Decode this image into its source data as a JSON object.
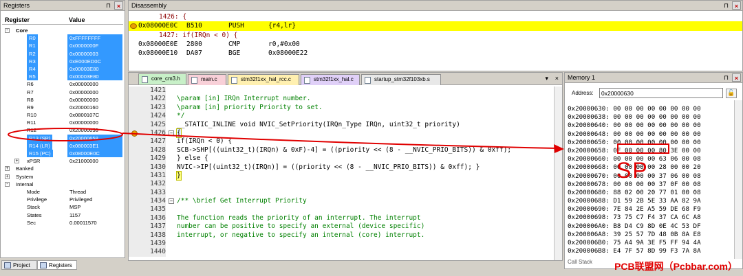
{
  "registers": {
    "title": "Registers",
    "col_register": "Register",
    "col_value": "Value",
    "rows": [
      {
        "name": "Core",
        "value": "",
        "indent": 0,
        "toggle": "-",
        "sel": false,
        "bold": true
      },
      {
        "name": "R0",
        "value": "0xFFFFFFFF",
        "indent": 2,
        "toggle": "",
        "sel": true
      },
      {
        "name": "R1",
        "value": "0x0000000F",
        "indent": 2,
        "toggle": "",
        "sel": true
      },
      {
        "name": "R2",
        "value": "0x00000003",
        "indent": 2,
        "toggle": "",
        "sel": true
      },
      {
        "name": "R3",
        "value": "0xE000ED0C",
        "indent": 2,
        "toggle": "",
        "sel": true
      },
      {
        "name": "R4",
        "value": "0x00003E80",
        "indent": 2,
        "toggle": "",
        "sel": true
      },
      {
        "name": "R5",
        "value": "0x00003E80",
        "indent": 2,
        "toggle": "",
        "sel": true
      },
      {
        "name": "R6",
        "value": "0x00000000",
        "indent": 2,
        "toggle": "",
        "sel": false
      },
      {
        "name": "R7",
        "value": "0x00000000",
        "indent": 2,
        "toggle": "",
        "sel": false
      },
      {
        "name": "R8",
        "value": "0x00000000",
        "indent": 2,
        "toggle": "",
        "sel": false
      },
      {
        "name": "R9",
        "value": "0x20000160",
        "indent": 2,
        "toggle": "",
        "sel": false
      },
      {
        "name": "R10",
        "value": "0x0800107C",
        "indent": 2,
        "toggle": "",
        "sel": false
      },
      {
        "name": "R11",
        "value": "0x00000000",
        "indent": 2,
        "toggle": "",
        "sel": false
      },
      {
        "name": "R12",
        "value": "0x20000058",
        "indent": 2,
        "toggle": "",
        "sel": false
      },
      {
        "name": "R13 (SP)",
        "value": "0x20000658",
        "indent": 2,
        "toggle": "",
        "sel": true
      },
      {
        "name": "R14 (LR)",
        "value": "0x080003E1",
        "indent": 2,
        "toggle": "",
        "sel": true
      },
      {
        "name": "R15 (PC)",
        "value": "0x08000E0C",
        "indent": 2,
        "toggle": "",
        "sel": true
      },
      {
        "name": "xPSR",
        "value": "0x21000000",
        "indent": 2,
        "toggle": "+",
        "sel": false
      },
      {
        "name": "Banked",
        "value": "",
        "indent": 0,
        "toggle": "+",
        "sel": false
      },
      {
        "name": "System",
        "value": "",
        "indent": 0,
        "toggle": "+",
        "sel": false
      },
      {
        "name": "Internal",
        "value": "",
        "indent": 0,
        "toggle": "-",
        "sel": false
      },
      {
        "name": "Mode",
        "value": "Thread",
        "indent": 2,
        "toggle": "",
        "sel": false
      },
      {
        "name": "Privilege",
        "value": "Privileged",
        "indent": 2,
        "toggle": "",
        "sel": false
      },
      {
        "name": "Stack",
        "value": "MSP",
        "indent": 2,
        "toggle": "",
        "sel": false
      },
      {
        "name": "States",
        "value": "1157",
        "indent": 2,
        "toggle": "",
        "sel": false
      },
      {
        "name": "Sec",
        "value": "0.00011570",
        "indent": 2,
        "toggle": "",
        "sel": false
      }
    ],
    "tab_project": "Project",
    "tab_registers": "Registers"
  },
  "disassembly": {
    "title": "Disassembly",
    "rows": [
      {
        "text": "1426: {",
        "src": true,
        "hl": false,
        "a": "",
        "b": "",
        "c": "",
        "d": ""
      },
      {
        "text": "",
        "src": false,
        "hl": true,
        "a": "0x08000E0C",
        "b": "B510",
        "c": "PUSH",
        "d": "{r4,lr}"
      },
      {
        "text": "1427:   if(IRQn < 0) {",
        "src": true,
        "hl": false,
        "a": "",
        "b": "",
        "c": "",
        "d": ""
      },
      {
        "text": "",
        "src": false,
        "hl": false,
        "a": "0x08000E0E",
        "b": "2800",
        "c": "CMP",
        "d": "r0,#0x00"
      },
      {
        "text": "",
        "src": false,
        "hl": false,
        "a": "0x08000E10",
        "b": "DA07",
        "c": "BGE",
        "d": "0x08000E22"
      }
    ]
  },
  "editor": {
    "tabs": [
      {
        "label": "core_cm3.h",
        "color": "#c8f0c8",
        "active": true
      },
      {
        "label": "main.c",
        "color": "#f8d0d8",
        "active": false
      },
      {
        "label": "stm32f1xx_hal_rcc.c",
        "color": "#fff0b0",
        "active": false
      },
      {
        "label": "stm32f1xx_hal.c",
        "color": "#e0d0f8",
        "active": false
      },
      {
        "label": "startup_stm32f103xb.s",
        "color": "#e8e8e8",
        "active": false
      }
    ],
    "lines": [
      {
        "n": "1421",
        "t": "",
        "cls": "cmt"
      },
      {
        "n": "1422",
        "t": "  \\param [in]      IRQn  Interrupt number.",
        "cls": "cmt"
      },
      {
        "n": "1423",
        "t": "  \\param [in]  priority  Priority to set.",
        "cls": "cmt"
      },
      {
        "n": "1424",
        "t": "*/",
        "cls": "cmt"
      },
      {
        "n": "1425",
        "t": "__STATIC_INLINE void NVIC_SetPriority(IRQn_Type IRQn, uint32_t priority)",
        "cls": ""
      },
      {
        "n": "1426",
        "t": "{",
        "cls": "cur"
      },
      {
        "n": "1427",
        "t": "  if(IRQn < 0) {",
        "cls": ""
      },
      {
        "n": "1428",
        "t": "    SCB->SHP[((uint32_t)(IRQn) & 0xF)-4] = ((priority << (8 - __NVIC_PRIO_BITS)) & 0xff);",
        "cls": ""
      },
      {
        "n": "1429",
        "t": "  } else {",
        "cls": ""
      },
      {
        "n": "1430",
        "t": "    NVIC->IP[(uint32_t)(IRQn)] = ((priority << (8 - __NVIC_PRIO_BITS)) & 0xff);    }",
        "cls": ""
      },
      {
        "n": "1431",
        "t": "}",
        "cls": ""
      },
      {
        "n": "1432",
        "t": "",
        "cls": ""
      },
      {
        "n": "1433",
        "t": "",
        "cls": ""
      },
      {
        "n": "1434",
        "t": "/** \\brief  Get Interrupt Priority",
        "cls": "cmt"
      },
      {
        "n": "1435",
        "t": "",
        "cls": "cmt"
      },
      {
        "n": "1436",
        "t": "  The function reads the priority of an interrupt. The interrupt",
        "cls": "cmt"
      },
      {
        "n": "1437",
        "t": "  number can be positive to specify an external (device specific)",
        "cls": "cmt"
      },
      {
        "n": "1438",
        "t": "  interrupt, or negative to specify an internal (core) interrupt.",
        "cls": "cmt"
      },
      {
        "n": "1439",
        "t": "",
        "cls": "cmt"
      },
      {
        "n": "1440",
        "t": "",
        "cls": "cmt"
      }
    ]
  },
  "memory": {
    "title": "Memory 1",
    "address_label": "Address:",
    "address_value": "0x20000630",
    "rows": [
      "0x20000630: 00 00 00 00 00 00 00 00",
      "0x20000638: 00 00 00 00 00 00 00 00",
      "0x20000640: 00 00 00 00 00 00 00 00",
      "0x20000648: 00 00 00 00 00 00 00 00",
      "0x20000650: 00 00 00 00 00 00 00 00",
      "0x20000658: 0F 00 00 00 80 3E 00 00",
      "0x20000660: 00 00 00 00 63 06 00 08",
      "0x20000668: 00 00 00 00 28 00 00 20",
      "0x20000670: 00 00 00 00 37 06 00 08",
      "0x20000678: 00 00 00 00 37 0F 00 08",
      "0x20000680: 88 02 00 20 77 01 00 08",
      "0x20000688: D1 59 2B 5E 33 AA 82 9A",
      "0x20000690: 7E 84 2E A5 59 DE 68 F9",
      "0x20000698: 73 75 C7 F4 37 CA 6C A8",
      "0x200006A0: B8 D4 C9 8D 0E 4C 53 DF",
      "0x200006A8: 39 25 57 7D 48 0B 8A E8",
      "0x200006B0: 75 A4 9A 3E F5 FF 94 4A",
      "0x200006B8: E4 7F 57 8D 99 F3 7A 8A"
    ],
    "call_stack_tab": "Call Stack"
  },
  "annotation": {
    "sp_label": "SP",
    "watermark": "PCB联盟网（Pcbbar.com）",
    "color": "#e00000"
  }
}
